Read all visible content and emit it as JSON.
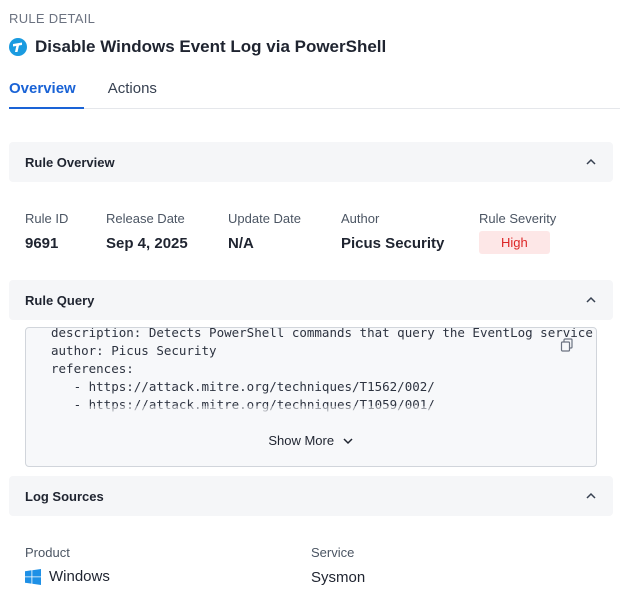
{
  "header": {
    "kicker": "RULE DETAIL",
    "title": "Disable Windows Event Log via PowerShell"
  },
  "tabs": [
    {
      "label": "Overview",
      "active": true
    },
    {
      "label": "Actions",
      "active": false
    }
  ],
  "overview": {
    "section_title": "Rule Overview",
    "fields": {
      "rule_id": {
        "label": "Rule ID",
        "value": "9691"
      },
      "release_date": {
        "label": "Release Date",
        "value": "Sep 4, 2025"
      },
      "update_date": {
        "label": "Update Date",
        "value": "N/A"
      },
      "author": {
        "label": "Author",
        "value": "Picus Security"
      },
      "severity": {
        "label": "Rule Severity",
        "value": "High"
      }
    }
  },
  "query": {
    "section_title": "Rule Query",
    "lines": [
      "description: Detects PowerShell commands that query the EventLog service",
      "author: Picus Security",
      "references:",
      "   - https://attack.mitre.org/techniques/T1562/002/",
      "   - https://attack.mitre.org/techniques/T1059/001/"
    ],
    "show_more_label": "Show More"
  },
  "log_sources": {
    "section_title": "Log Sources",
    "product_label": "Product",
    "product_value": "Windows",
    "service_label": "Service",
    "service_value": "Sysmon"
  },
  "colors": {
    "accent": "#1a63d6",
    "severity_high_text": "#dc2626",
    "severity_high_bg": "#fde7e7",
    "section_bg": "#f5f6f8"
  },
  "icons": {
    "brand": "picus-logo-icon",
    "collapse": "chevron-up-icon",
    "copy": "copy-icon",
    "expand": "chevron-down-icon",
    "product": "windows-icon"
  }
}
